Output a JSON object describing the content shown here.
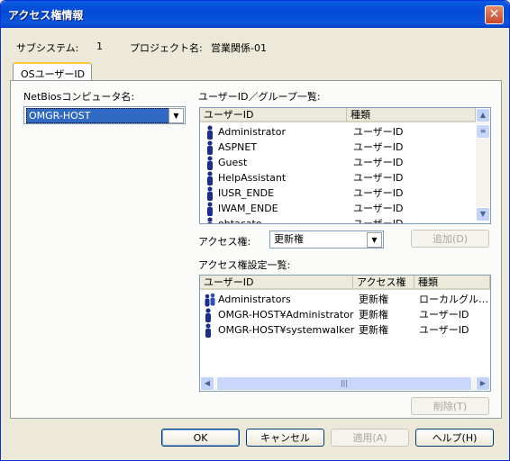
{
  "window": {
    "title": "アクセス権情報",
    "close_glyph": "✕"
  },
  "info": {
    "subsystem_label": "サブシステム:",
    "subsystem_value": "1",
    "project_label": "プロジェクト名:",
    "project_value": "営業関係-01"
  },
  "tab": {
    "label": "OSユーザーID"
  },
  "netbios": {
    "label": "NetBiosコンピュータ名:",
    "value": "OMGR-HOST"
  },
  "user_list": {
    "label": "ユーザーID／グループ一覧:",
    "columns": [
      "ユーザーID",
      "種類"
    ],
    "rows": [
      {
        "name": "Administrator",
        "type": "ユーザーID"
      },
      {
        "name": "ASPNET",
        "type": "ユーザーID"
      },
      {
        "name": "Guest",
        "type": "ユーザーID"
      },
      {
        "name": "HelpAssistant",
        "type": "ユーザーID"
      },
      {
        "name": "IUSR_ENDE",
        "type": "ユーザーID"
      },
      {
        "name": "IWAM_ENDE",
        "type": "ユーザーID"
      },
      {
        "name": "ohtacato",
        "type": "ユーザーID"
      }
    ]
  },
  "access": {
    "label": "アクセス権:",
    "value": "更新権",
    "add_button": "追加(D)"
  },
  "access_list": {
    "label": "アクセス権設定一覧:",
    "columns": [
      "ユーザーID",
      "アクセス権",
      "種類"
    ],
    "rows": [
      {
        "name": "Administrators",
        "access": "更新権",
        "type": "ローカルグル…",
        "icon": "group-icon"
      },
      {
        "name": "OMGR-HOST¥Administrator",
        "access": "更新権",
        "type": "ユーザーID",
        "icon": "user-icon"
      },
      {
        "name": "OMGR-HOST¥systemwalker",
        "access": "更新権",
        "type": "ユーザーID",
        "icon": "user-icon"
      }
    ],
    "delete_button": "削除(T)"
  },
  "footer": {
    "ok": "OK",
    "cancel": "キャンセル",
    "apply": "適用(A)",
    "help": "ヘルプ(H)"
  },
  "colors": {
    "titlebar": "#0a5ce0",
    "dialog": "#ece9d8",
    "selection": "#316ac5",
    "icon": "#1a2e8a"
  }
}
